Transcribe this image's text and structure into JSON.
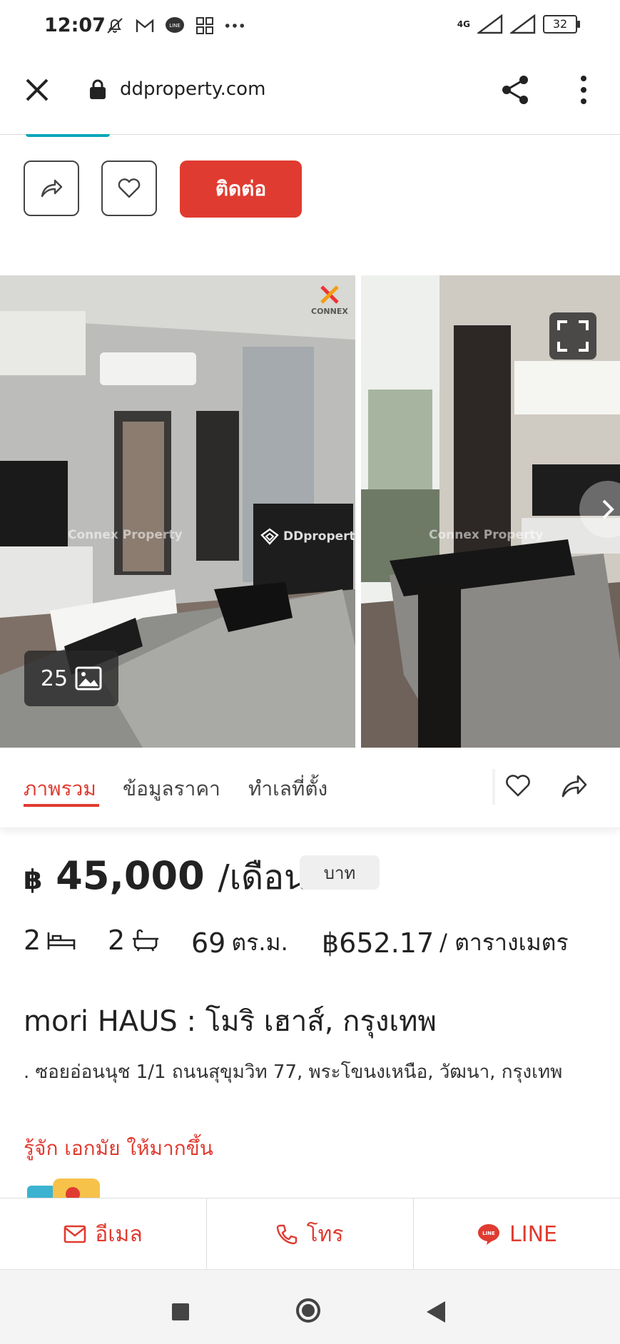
{
  "status_bar": {
    "time": "12:07",
    "network": "4G",
    "battery": "32"
  },
  "browser": {
    "url": "ddproperty.com"
  },
  "actions": {
    "contact_label": "ติดต่อ"
  },
  "gallery": {
    "photo_count": "25",
    "watermark_left": "Connex Property",
    "watermark_brand": "DDproperty",
    "watermark_right": "Connex Property",
    "logo_text": "CONNEX"
  },
  "tabs": [
    {
      "label": "ภาพรวม",
      "active": true
    },
    {
      "label": "ข้อมูลราคา",
      "active": false
    },
    {
      "label": "ทำเลที่ตั้ง",
      "active": false
    }
  ],
  "listing": {
    "currency_symbol": "฿",
    "price": "45,000",
    "per": "/เดือน",
    "unit_chip": "บาท",
    "bedrooms": "2",
    "bathrooms": "2",
    "area_value": "69",
    "area_unit": "ตร.ม.",
    "price_per_sqm": "฿652.17",
    "price_per_sqm_unit": "/ ตารางเมตร",
    "title": "mori HAUS : โมริ เฮาส์, กรุงเทพ",
    "address": ". ซอยอ่อนนุช 1/1 ถนนสุขุมวิท 77, พระโขนงเหนือ, วัฒนา, กรุงเทพ",
    "know_more": "รู้จัก เอกมัย ให้มากขึ้น"
  },
  "bottom_bar": {
    "email_label": "อีเมล",
    "call_label": "โทร",
    "line_label": "LINE"
  },
  "colors": {
    "accent": "#e03b30",
    "teal": "#0aa6b8"
  }
}
